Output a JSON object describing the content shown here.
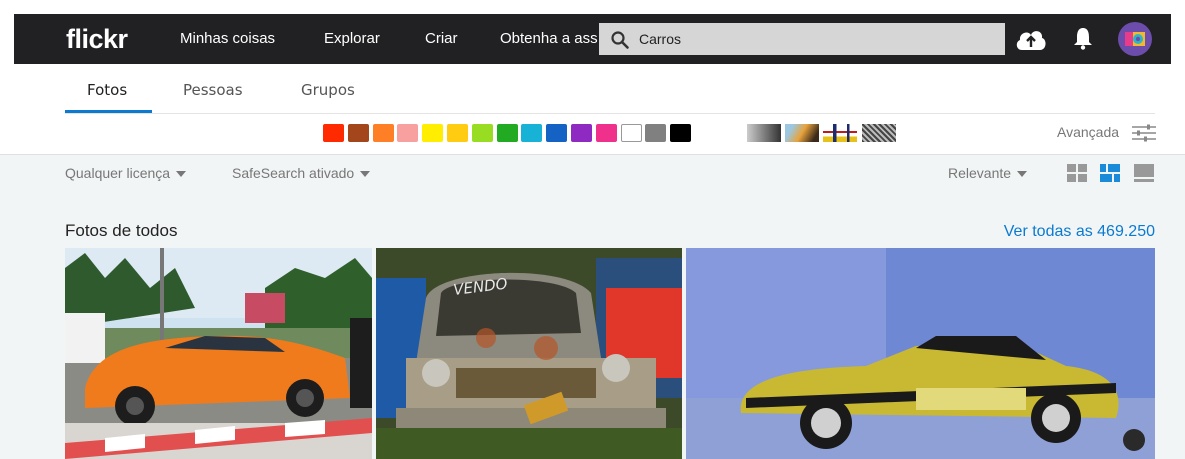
{
  "nav": {
    "logo": "flickr",
    "links": [
      "Minhas coisas",
      "Explorar",
      "Criar",
      "Obtenha a ass"
    ],
    "search_value": "Carros"
  },
  "tabs": [
    "Fotos",
    "Pessoas",
    "Grupos"
  ],
  "color_swatches": [
    "#ff2a00",
    "#a4461c",
    "#ff7f27",
    "#f8a0a0",
    "#ffee00",
    "#ffcc11",
    "#99dd22",
    "#22aa22",
    "#17b2d6",
    "#1463c4",
    "#8e2ac2",
    "#f0318c",
    "#ffffff",
    "#808080",
    "#000000"
  ],
  "textures": [
    "black-and-white",
    "shallow-depth",
    "minimalism",
    "patterns"
  ],
  "advanced_label": "Avançada",
  "filters": {
    "license": "Qualquer licença",
    "safesearch": "SafeSearch ativado",
    "sort": "Relevante"
  },
  "section": {
    "title": "Fotos de todos",
    "see_all": "Ver todas as 469.250"
  },
  "photos": [
    {
      "subject": "orange-coupe",
      "text": ""
    },
    {
      "subject": "rusty-truck",
      "text": "VENDO"
    },
    {
      "subject": "yellow-muscle-car",
      "text": ""
    }
  ],
  "colors": {
    "accent": "#0b7ad0",
    "nav_bg": "#212124",
    "page_bg": "#f2f5f6"
  }
}
